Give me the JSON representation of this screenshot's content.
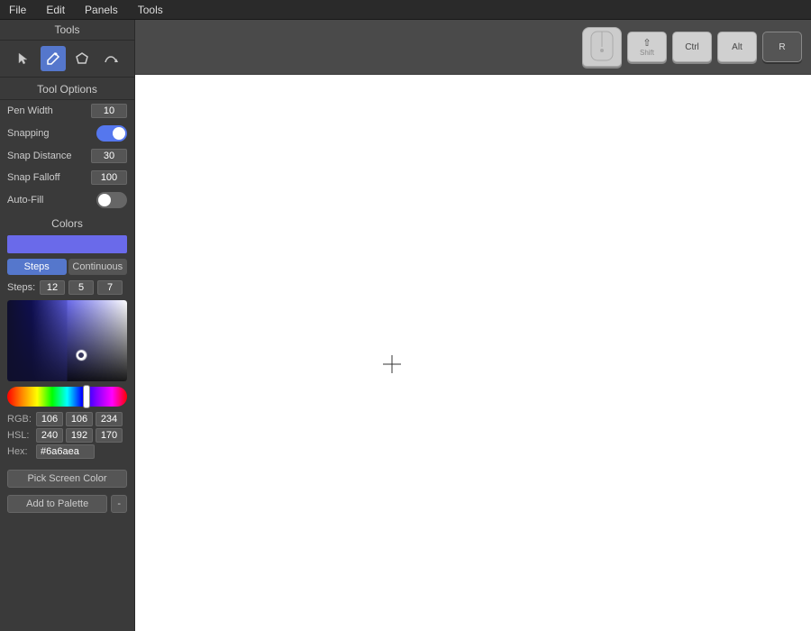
{
  "menuBar": {
    "items": [
      "File",
      "Edit",
      "Panels",
      "Tools"
    ]
  },
  "toolbar": {
    "tools": [
      {
        "name": "select",
        "icon": "↖",
        "active": false
      },
      {
        "name": "pen",
        "icon": "✏",
        "active": true
      },
      {
        "name": "shape",
        "icon": "⬡",
        "active": false
      },
      {
        "name": "path",
        "icon": "↩",
        "active": false
      }
    ]
  },
  "toolOptions": {
    "title": "Tool Options",
    "penWidth": {
      "label": "Pen Width",
      "value": "10"
    },
    "snapping": {
      "label": "Snapping",
      "value": true
    },
    "snapDistance": {
      "label": "Snap Distance",
      "value": "30"
    },
    "snapFalloff": {
      "label": "Snap Falloff",
      "value": "100"
    },
    "autoFill": {
      "label": "Auto-Fill",
      "value": false
    }
  },
  "colors": {
    "title": "Colors",
    "previewColor": "#6a6aea",
    "modes": [
      "Steps",
      "Continuous"
    ],
    "activeMode": "Steps",
    "steps": {
      "label": "Steps:",
      "values": [
        "12",
        "5",
        "7"
      ]
    },
    "rgb": {
      "label": "RGB:",
      "r": "106",
      "g": "106",
      "b": "234"
    },
    "hsl": {
      "label": "HSL:",
      "h": "240",
      "s": "192",
      "l": "170"
    },
    "hex": {
      "label": "Hex:",
      "value": "#6a6aea"
    },
    "pickScreenColor": "Pick Screen Color",
    "addToPalette": "Add to Palette",
    "minus": "-"
  },
  "shortcuts": {
    "mouse": "mouse",
    "shift": "Shift",
    "shiftIcon": "⇧",
    "ctrl": "Ctrl",
    "alt": "Alt",
    "key": "R"
  }
}
